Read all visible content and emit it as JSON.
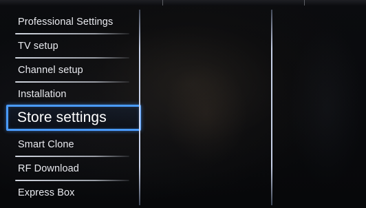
{
  "menu": {
    "items": [
      {
        "label": "Professional Settings",
        "selected": false
      },
      {
        "label": "TV setup",
        "selected": false
      },
      {
        "label": "Channel setup",
        "selected": false
      },
      {
        "label": "Installation",
        "selected": false
      },
      {
        "label": "Store settings",
        "selected": true
      },
      {
        "label": "Smart Clone",
        "selected": false
      },
      {
        "label": "RF Download",
        "selected": false
      },
      {
        "label": "Express Box",
        "selected": false
      }
    ]
  },
  "colors": {
    "accent": "#4a9bff",
    "text": "#e9eaef",
    "background": "#07080a"
  }
}
